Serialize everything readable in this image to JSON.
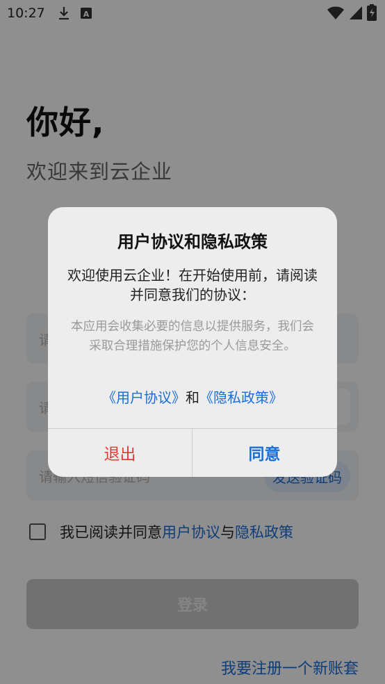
{
  "status_bar": {
    "time": "10:27",
    "icons": [
      "download-icon",
      "font-a-icon",
      "wifi-icon",
      "signal-icon",
      "battery-charging-icon"
    ]
  },
  "page": {
    "greeting": "你好,",
    "welcome": "欢迎来到云企业"
  },
  "form": {
    "field1_placeholder": "请",
    "field2_placeholder": "请",
    "sms_placeholder": "请输入短信验证码",
    "sms_button": "发送验证码",
    "agree_prefix": "我已阅读并同意",
    "agree_user_agreement": "用户协议",
    "agree_and": "与",
    "agree_privacy_policy": "隐私政策",
    "login_button": "登录",
    "register_link": "我要注册一个新账套"
  },
  "dialog": {
    "title": "用户协议和隐私政策",
    "message": "欢迎使用云企业！在开始使用前，请阅读并同意我们的协议：",
    "note": "本应用会收集必要的信息以提供服务，我们会采取合理措施保护您的个人信息安全。",
    "link_user_agreement": "《用户协议》",
    "link_and": "和",
    "link_privacy_policy": "《隐私政策》",
    "exit_button": "退出",
    "agree_button": "同意"
  },
  "colors": {
    "accent": "#1a6ed8",
    "danger": "#e53935",
    "overlay": "rgba(0,0,0,0.44)"
  }
}
